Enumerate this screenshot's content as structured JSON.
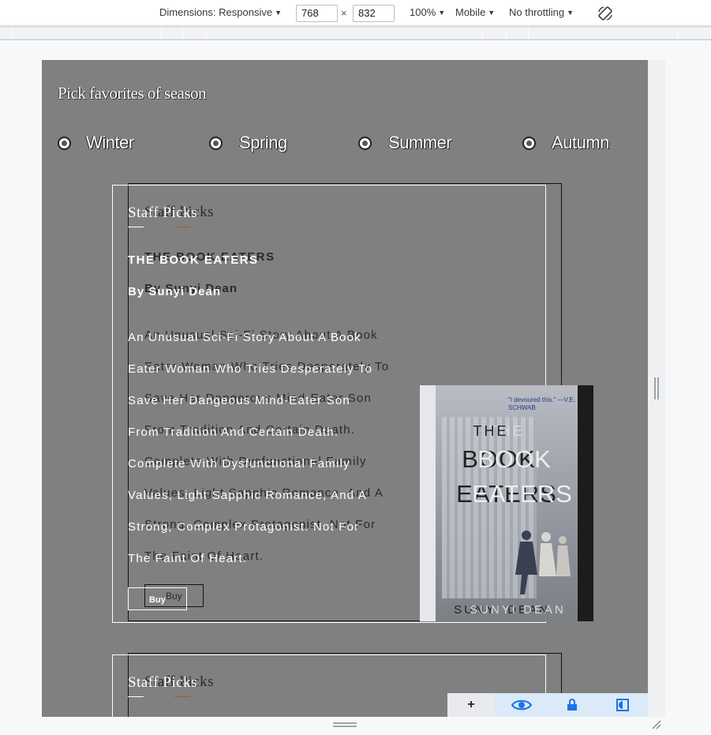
{
  "toolbar": {
    "dimensions_label": "Dimensions: Responsive",
    "width": "768",
    "times": "×",
    "height": "832",
    "zoom": "100%",
    "device_type": "Mobile",
    "throttling": "No throttling",
    "icons": [
      "dropdown-arrow-icon",
      "rotate-icon"
    ]
  },
  "page": {
    "heading": "Pick favorites of season",
    "seasons": [
      "Winter",
      "Spring",
      "Summer",
      "Autumn"
    ]
  },
  "cards": [
    {
      "section_title": "Staff Picks",
      "book_title": "THE BOOK EATERS",
      "author": "By Sunyi Dean",
      "description_lines_a": [
        "An Unusual Sci-Fi Story About A Book",
        "Eater Woman Who Tries Desperately To",
        "Save Her Dangeous Mind-Eater Son",
        "From Tradition And Certain Death.",
        "Complete With Dysfunctional Family",
        "Values, Light Sapphic Romance, And A",
        "Strong, Complex Protagonist. Not For",
        "The Faint Of Heart."
      ],
      "description_lines_b": [
        "An Unusual Sci-Fi Story About A Book",
        "Eater Woman Who Tries Desperately To",
        "Save Her Dangerous Mind-Eater Son",
        "From Tradition And Certain Death.",
        "Complete With Dysfunctional Family",
        "Values, Light Sapphic Romance, And A",
        "Strong, Complex Protagonist. Not For",
        "The Faint Of Heart."
      ],
      "buy_label": "Buy",
      "cover": {
        "the": "THE",
        "book": "BOOK",
        "eaters": "EATERS",
        "author": "SUNYI DEAN",
        "blurb": "\"I devoured this.\" —V.E. SCHWAB"
      }
    },
    {
      "section_title": "Staff Picks"
    }
  ],
  "overlay": {
    "plus": "+",
    "icons": [
      "eye-icon",
      "lock-icon",
      "contrast-icon"
    ]
  },
  "colors": {
    "viewport_bg": "#808080",
    "accent_underline": "#b3561d",
    "devtools_blue": "#1a73e8"
  }
}
